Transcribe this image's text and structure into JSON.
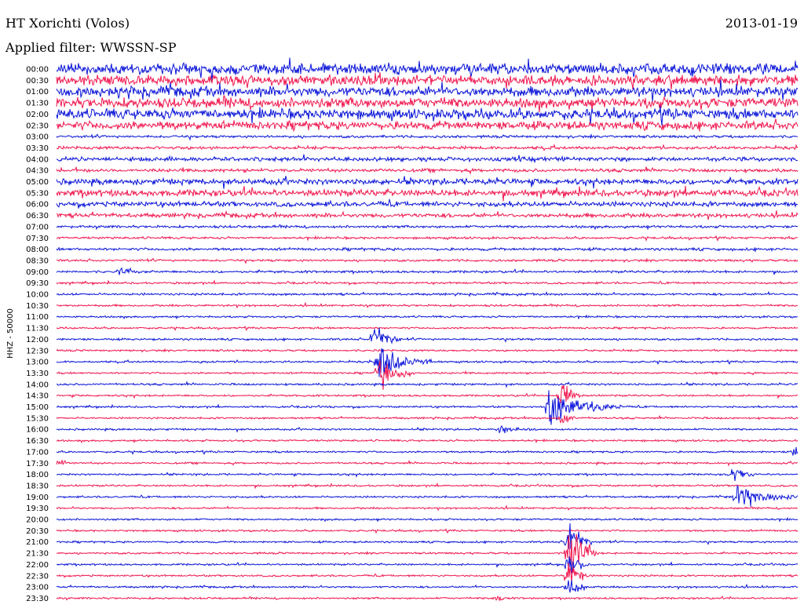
{
  "header": {
    "station": "HT Xorichti (Volos)",
    "filter": "Applied filter: WWSSN-SP",
    "date": "2013-01-19"
  },
  "colors": {
    "trace_odd": "#0a14d8",
    "trace_even": "#f0174f",
    "text": "#000000",
    "background": "#ffffff"
  },
  "chart_data": {
    "type": "line",
    "title": "HT Xorichti (Volos)",
    "subtitle": "Applied filter: WWSSN-SP",
    "ylabel": "HHZ - 50000",
    "x": "minutes within each 30-minute row (0–30)",
    "rows": [
      "00:00",
      "00:30",
      "01:00",
      "01:30",
      "02:00",
      "02:30",
      "03:00",
      "03:30",
      "04:00",
      "04:30",
      "05:00",
      "05:30",
      "06:00",
      "06:30",
      "07:00",
      "07:30",
      "08:00",
      "08:30",
      "09:00",
      "09:30",
      "10:00",
      "10:30",
      "11:00",
      "11:30",
      "12:00",
      "12:30",
      "13:00",
      "13:30",
      "14:00",
      "14:30",
      "15:00",
      "15:30",
      "16:00",
      "16:30",
      "17:00",
      "17:30",
      "18:00",
      "18:30",
      "19:00",
      "19:30",
      "20:00",
      "20:30",
      "21:00",
      "21:30",
      "22:00",
      "22:30",
      "23:00",
      "23:30"
    ],
    "series_colors": [
      "blue",
      "red"
    ],
    "noise_level": [
      6.5,
      6,
      6,
      6,
      6,
      5,
      1.5,
      1.8,
      2.5,
      2,
      3.5,
      4,
      3,
      2.5,
      1.5,
      1.3,
      1.6,
      1.3,
      1.4,
      1.2,
      1.3,
      1.2,
      1.1,
      1.1,
      1.2,
      1.1,
      1.1,
      1.1,
      1.2,
      1.1,
      1.1,
      1.1,
      1.1,
      1.1,
      1.1,
      1.1,
      1.1,
      1.1,
      1.1,
      1.1,
      1.1,
      1.1,
      1.1,
      1.1,
      1.1,
      1.1,
      1.1,
      1.1
    ],
    "events": [
      {
        "row": 18,
        "t": 2.5,
        "amp": 9,
        "dur": 1.5
      },
      {
        "row": 24,
        "t": 12.8,
        "amp": 30,
        "dur": 1.2
      },
      {
        "row": 26,
        "t": 13.0,
        "amp": 30,
        "dur": 2.2
      },
      {
        "row": 27,
        "t": 13.0,
        "amp": 30,
        "dur": 1.5
      },
      {
        "row": 30,
        "t": 19.9,
        "amp": 30,
        "dur": 3.0
      },
      {
        "row": 29,
        "t": 20.4,
        "amp": 30,
        "dur": 0.8
      },
      {
        "row": 31,
        "t": 20.4,
        "amp": 18,
        "dur": 0.7
      },
      {
        "row": 32,
        "t": 17.9,
        "amp": 8,
        "dur": 1.5
      },
      {
        "row": 34,
        "t": 29.8,
        "amp": 14,
        "dur": 0.5
      },
      {
        "row": 35,
        "t": 0.1,
        "amp": 10,
        "dur": 0.5
      },
      {
        "row": 36,
        "t": 27.3,
        "amp": 14,
        "dur": 1.2
      },
      {
        "row": 38,
        "t": 27.5,
        "amp": 22,
        "dur": 2.5
      },
      {
        "row": 43,
        "t": 20.7,
        "amp": 60,
        "dur": 1.2
      },
      {
        "row": 42,
        "t": 20.7,
        "amp": 40,
        "dur": 1.0
      },
      {
        "row": 44,
        "t": 20.7,
        "amp": 30,
        "dur": 0.8
      },
      {
        "row": 45,
        "t": 20.7,
        "amp": 30,
        "dur": 0.8
      },
      {
        "row": 46,
        "t": 20.7,
        "amp": 25,
        "dur": 0.8
      },
      {
        "row": 47,
        "t": 17.8,
        "amp": 10,
        "dur": 0.5
      }
    ]
  }
}
